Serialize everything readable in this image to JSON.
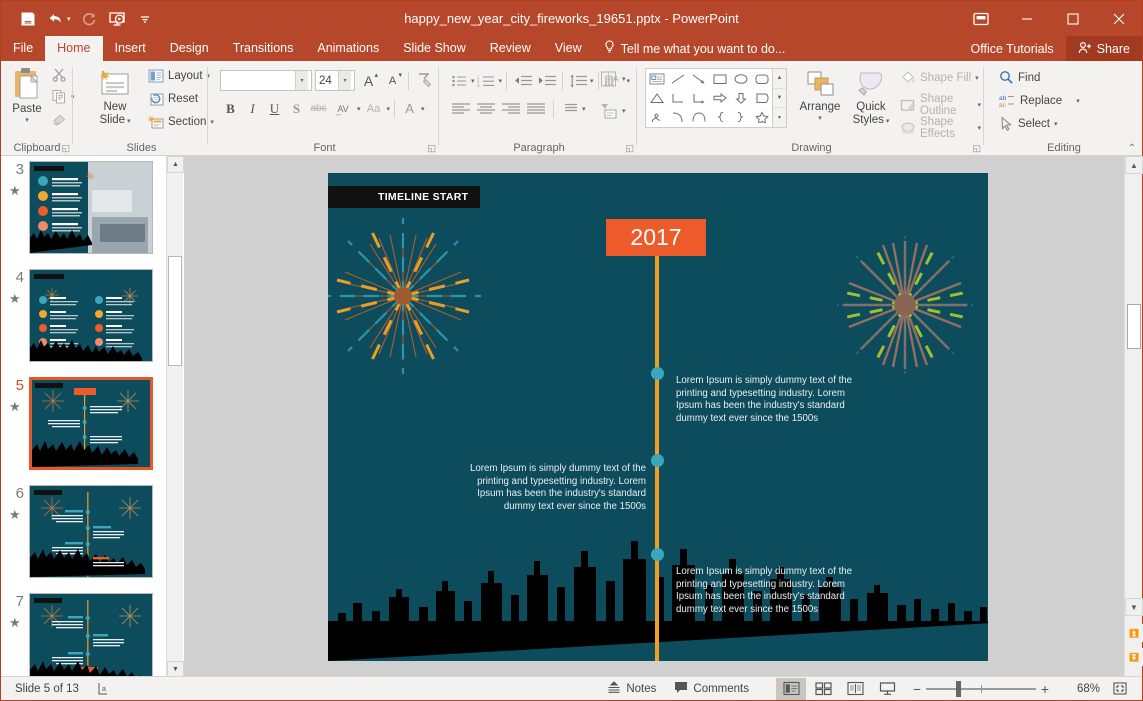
{
  "window": {
    "title": "happy_new_year_city_fireworks_19651.pptx - PowerPoint",
    "quick_access": [
      {
        "name": "save",
        "glyph": "save-icon"
      },
      {
        "name": "undo",
        "glyph": "undo-icon"
      },
      {
        "name": "redo",
        "glyph": "redo-icon"
      },
      {
        "name": "start-presentation",
        "glyph": "presentation-icon"
      },
      {
        "name": "customize-quick-access",
        "glyph": "chevron-down-icon"
      }
    ],
    "controls": {
      "ribbon_display": "ribbon-display-options",
      "minimize": "–",
      "maximize": "☐",
      "close": "✕"
    }
  },
  "tabs": [
    {
      "label": "File",
      "active": false
    },
    {
      "label": "Home",
      "active": true
    },
    {
      "label": "Insert",
      "active": false
    },
    {
      "label": "Design",
      "active": false
    },
    {
      "label": "Transitions",
      "active": false
    },
    {
      "label": "Animations",
      "active": false
    },
    {
      "label": "Slide Show",
      "active": false
    },
    {
      "label": "Review",
      "active": false
    },
    {
      "label": "View",
      "active": false
    }
  ],
  "tellme": {
    "label": "Tell me what you want to do...",
    "icon": "lightbulb-icon"
  },
  "account": {
    "label": "Office Tutorials"
  },
  "share": {
    "label": "Share",
    "icon": "share-person-icon"
  },
  "ribbon": {
    "groups": [
      {
        "name": "clipboard",
        "label": "Clipboard"
      },
      {
        "name": "slides",
        "label": "Slides"
      },
      {
        "name": "font",
        "label": "Font"
      },
      {
        "name": "paragraph",
        "label": "Paragraph"
      },
      {
        "name": "drawing",
        "label": "Drawing"
      },
      {
        "name": "editing",
        "label": "Editing"
      }
    ],
    "clipboard": {
      "paste": "Paste",
      "cut": "Cut",
      "copy": "Copy",
      "format_painter": "Format Painter"
    },
    "slides": {
      "new_slide": "New\nSlide",
      "new_slide_line1": "New",
      "new_slide_line2": "Slide",
      "layout": "Layout",
      "reset": "Reset",
      "section": "Section"
    },
    "font": {
      "font_name": "",
      "font_name_placeholder": "",
      "font_size": "24",
      "grow": "A",
      "shrink": "A",
      "clear_formatting": "Clear All Formatting",
      "bold": "B",
      "italic": "I",
      "underline": "U",
      "shadow": "S",
      "strikethrough": "abc",
      "char_spacing": "AV",
      "change_case": "Aa",
      "font_color": "A"
    },
    "paragraph": {
      "bullets": "Bullets",
      "numbering": "Numbering",
      "decrease_indent": "Decrease List Level",
      "increase_indent": "Increase List Level",
      "line_spacing": "Line Spacing",
      "text_direction": "Text Direction",
      "align_text": "Align Text",
      "convert_smartart": "Convert to SmartArt",
      "align_left": "Align Left",
      "align_center": "Center",
      "align_right": "Align Right",
      "justify": "Justify",
      "columns": "Columns"
    },
    "drawing": {
      "arrange": "Arrange",
      "quick_styles_line1": "Quick",
      "quick_styles_line2": "Styles",
      "shape_fill": "Shape Fill",
      "shape_outline": "Shape Outline",
      "shape_effects": "Shape Effects",
      "shapes": [
        "textbox",
        "line",
        "arrow",
        "rectangle",
        "oval",
        "rounded-rectangle",
        "triangle",
        "elbow-connector",
        "elbow-arrow-connector",
        "right-arrow",
        "down-arrow",
        "pentagon-flag",
        "scribble",
        "curve",
        "arc",
        "left-brace",
        "right-brace",
        "star"
      ]
    },
    "editing": {
      "find": "Find",
      "replace": "Replace",
      "select": "Select"
    },
    "collapse": "Collapse the Ribbon"
  },
  "thumbnails": [
    {
      "number": "3",
      "animated": true,
      "selected": false,
      "kind": "photo-laptop"
    },
    {
      "number": "4",
      "animated": true,
      "selected": false,
      "kind": "two-column-icons"
    },
    {
      "number": "5",
      "animated": true,
      "selected": true,
      "kind": "timeline-center"
    },
    {
      "number": "6",
      "animated": true,
      "selected": false,
      "kind": "timeline-left"
    },
    {
      "number": "7",
      "animated": true,
      "selected": false,
      "kind": "timeline-bottom"
    }
  ],
  "slide": {
    "badge": "TIMELINE START",
    "year": "2017",
    "body_text": "Lorem Ipsum is simply dummy text of the printing and typesetting industry. Lorem Ipsum has been the industry's standard dummy text ever since the 1500s",
    "blocks": [
      {
        "align": "left",
        "text": "Lorem Ipsum is simply dummy text of the printing and typesetting industry. Lorem Ipsum has been the industry's standard dummy text ever since the 1500s"
      },
      {
        "align": "right",
        "text": "Lorem Ipsum is simply dummy text of the printing and typesetting industry. Lorem Ipsum has been the industry's standard dummy text ever since the 1500s"
      },
      {
        "align": "left",
        "text": "Lorem Ipsum is simply dummy text of the printing and typesetting industry. Lorem Ipsum has been the industry's standard dummy text ever since the 1500s"
      }
    ],
    "colors": {
      "background": "#0d4c5c",
      "accent_orange": "#ec5b29",
      "timeline_line": "#f0a020",
      "node": "#3aa7bd",
      "badge_bg": "#111111",
      "skyline": "#000000"
    }
  },
  "statusbar": {
    "slide_counter": "Slide 5 of 13",
    "language_icon": "spell-check-icon",
    "notes": "Notes",
    "comments": "Comments",
    "views": [
      {
        "name": "normal-view",
        "active": true
      },
      {
        "name": "slide-sorter-view",
        "active": false
      },
      {
        "name": "reading-view",
        "active": false
      },
      {
        "name": "slide-show-view",
        "active": false
      }
    ],
    "zoom_out": "−",
    "zoom_in": "+",
    "zoom_level": "68%",
    "fit_to_window": "fit-slide-icon"
  }
}
